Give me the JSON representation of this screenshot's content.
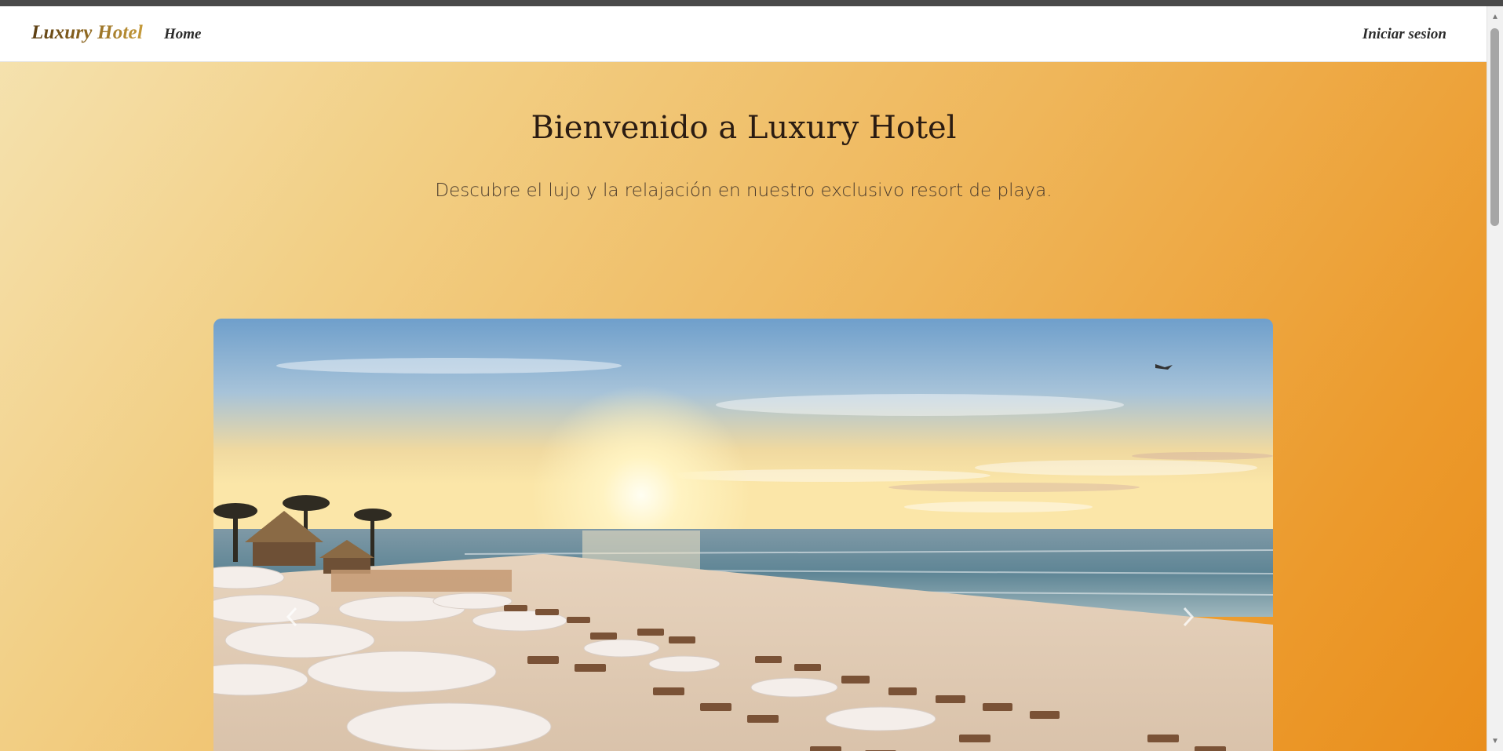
{
  "navbar": {
    "brand": "Luxury Hotel",
    "home_label": "Home",
    "login_label": "Iniciar sesion"
  },
  "hero": {
    "title": "Bienvenido a Luxury Hotel",
    "subtitle": "Descubre el lujo y la relajación en nuestro exclusivo resort de playa."
  },
  "carousel": {
    "image_subject": "beach-resort-sunset",
    "prev_icon": "chevron-left-icon",
    "next_icon": "chevron-right-icon"
  },
  "colors": {
    "gradient_start": "#f5e3b1",
    "gradient_end": "#e98e1c",
    "brand_gold": "#8a6420"
  }
}
